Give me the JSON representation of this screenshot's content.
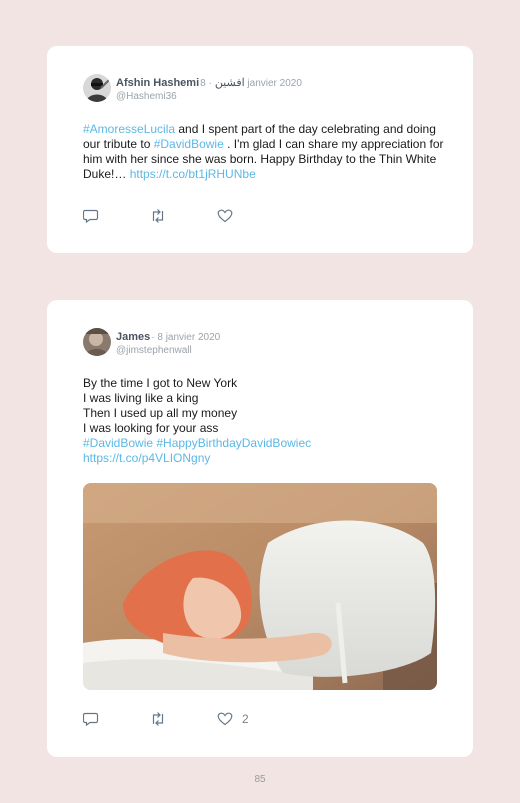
{
  "tweets": [
    {
      "author_name": "Afshin Hashemi",
      "author_name_alt": "افشین",
      "date": "· 8 janvier 2020",
      "handle": "@Hashemi36",
      "text": {
        "p1": "#AmoresseLucila",
        "p2": " and I spent part of the day celebrating and doing our tribute to ",
        "p3": "#DavidBowie",
        "p4": " . I'm glad I can share my appreciation for him with her since she was born. Happy Birthday to the Thin White Duke!… ",
        "p5": "https://t.co/bt1jRHUNbe"
      },
      "like_count": ""
    },
    {
      "author_name": "James",
      "date": "· 8 janvier 2020",
      "handle": "@jimstephenwall",
      "lines": [
        "By the time I got to New York",
        "I was living like a king",
        "Then I used up all my money",
        "I was looking for your ass"
      ],
      "hashtags": "#DavidBowie #HappyBirthdayDavidBowiec",
      "link": "https://t.co/p4VLIONgny",
      "like_count": "2"
    }
  ],
  "page_number": "85",
  "icons": [
    "reply-icon",
    "retweet-icon",
    "heart-icon"
  ],
  "colors": {
    "background": "#f3e4e4",
    "link": "#5bb8e6",
    "card": "#ffffff",
    "muted": "#9aa3ab"
  }
}
